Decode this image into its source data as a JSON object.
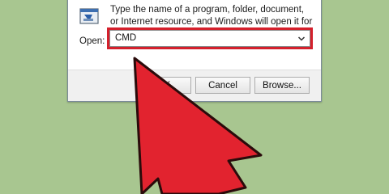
{
  "dialog": {
    "description": "Type the name of a program, folder, document, or Internet resource, and Windows will open it for you.",
    "open_label": "Open:",
    "open_value": "CMD",
    "highlight_color": "#d4202c",
    "icon": "run-icon"
  },
  "buttons": {
    "ok_label": "OK",
    "cancel_label": "Cancel",
    "browse_label": "Browse..."
  },
  "overlay": {
    "icon": "arrow-pointer-icon",
    "color": "#e2232f"
  }
}
